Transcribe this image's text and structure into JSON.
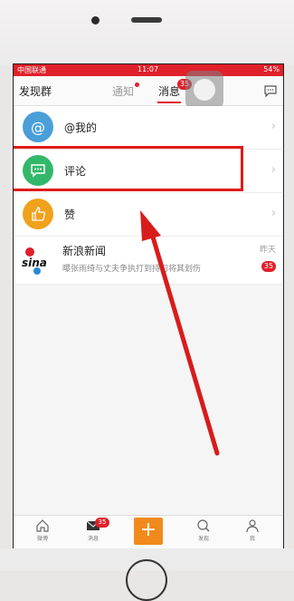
{
  "status": {
    "carrier": "中国联通",
    "time": "11:07",
    "battery": "54%"
  },
  "nav": {
    "left": "发现群",
    "tab_notice": "通知",
    "tab_message": "消息",
    "message_badge": "35"
  },
  "list": {
    "items": [
      {
        "label": "@我的",
        "icon": "at-icon",
        "color": "#4a9fd8"
      },
      {
        "label": "评论",
        "icon": "comment-icon",
        "color": "#33b86b"
      },
      {
        "label": "赞",
        "icon": "thumbs-up-icon",
        "color": "#f0a21c"
      }
    ],
    "news": {
      "title": "新浪新闻",
      "subtitle": "曝张雨绮与丈夫争执打到持刀将其划伤",
      "time": "昨天",
      "badge": "35",
      "logo_text": "sina"
    }
  },
  "tabbar": {
    "items": [
      {
        "label": "微博",
        "icon": "home-icon"
      },
      {
        "label": "消息",
        "icon": "mail-icon"
      },
      {
        "label": "+",
        "icon": "compose-icon"
      },
      {
        "label": "发现",
        "icon": "discover-icon"
      },
      {
        "label": "我",
        "icon": "profile-icon"
      }
    ],
    "message_badge": "35"
  },
  "annotation": {
    "highlight_color": "#e01b1b"
  }
}
